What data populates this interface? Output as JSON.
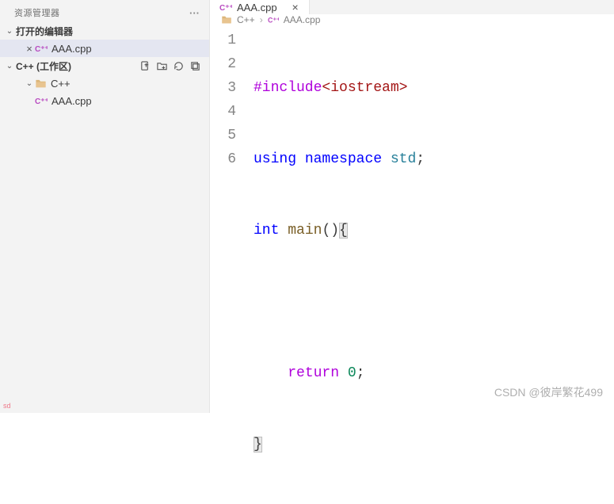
{
  "sidebar": {
    "title": "资源管理器",
    "openEditors": {
      "title": "打开的编辑器",
      "items": [
        {
          "label": "AAA.cpp"
        }
      ]
    },
    "workspace": {
      "title": "C++ (工作区)",
      "folder": "C++",
      "items": [
        {
          "label": "AAA.cpp"
        }
      ]
    }
  },
  "tab": {
    "label": "AAA.cpp"
  },
  "breadcrumb": {
    "folder": "C++",
    "file": "AAA.cpp"
  },
  "code": {
    "lines": [
      "1",
      "2",
      "3",
      "4",
      "5",
      "6"
    ],
    "l1a": "#include",
    "l1b": "<iostream>",
    "l2a": "using",
    "l2b": " ",
    "l2c": "namespace",
    "l2d": " ",
    "l2e": "std",
    "l2f": ";",
    "l3a": "int",
    "l3b": " ",
    "l3c": "main",
    "l3d": "()",
    "l3e": "{",
    "l4": "",
    "l5a": "    ",
    "l5b": "return",
    "l5c": " ",
    "l5d": "0",
    "l5e": ";",
    "l6": "}"
  },
  "watermarks": {
    "bl": "sd",
    "br": "CSDN @彼岸繁花499"
  }
}
